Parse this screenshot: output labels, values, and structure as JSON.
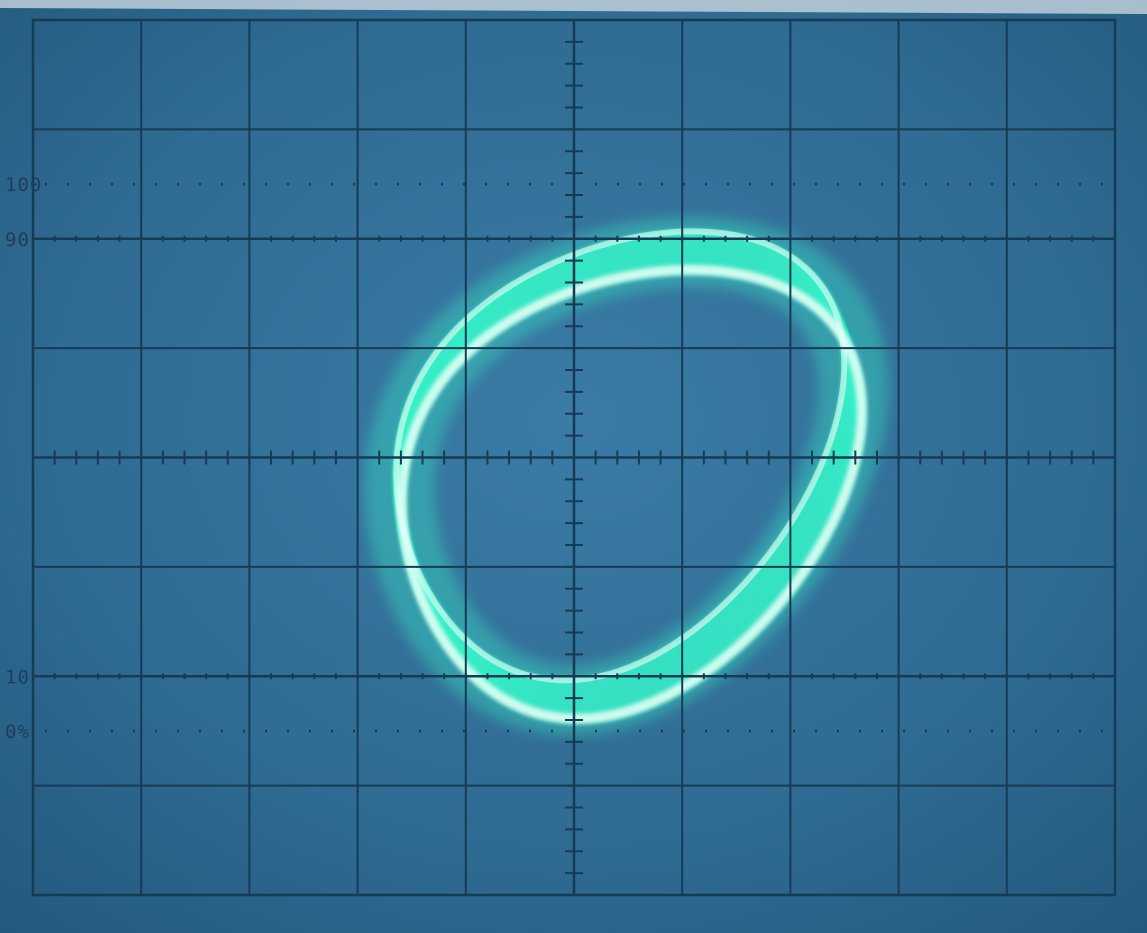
{
  "screen": {
    "phosphor_color": "#38f0c8",
    "trace_core_color": "#eafff8",
    "glass_color": "#2f6f98",
    "graticule_color": "#173b55"
  },
  "graticule": {
    "columns": 10,
    "rows": 8,
    "minor_ticks_per_division": 5,
    "markers": [
      {
        "text": "100",
        "level": 100
      },
      {
        "text": "90",
        "level": 90
      },
      {
        "text": "10",
        "level": 10
      },
      {
        "text": "0%",
        "level": 0
      }
    ]
  },
  "trace": {
    "type": "lissajous-loop",
    "passes": 16
  }
}
